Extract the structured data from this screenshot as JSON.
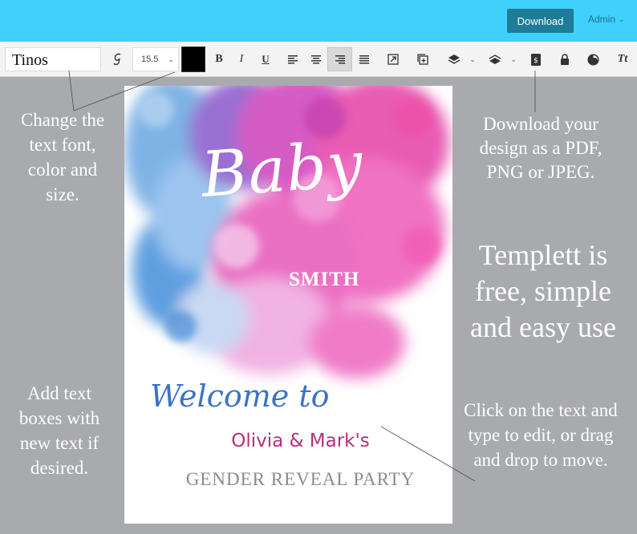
{
  "header": {
    "download_label": "Download",
    "admin_label": "Admin"
  },
  "toolbar": {
    "font_name": "Tinos",
    "font_size": "15.5",
    "text_color": "#000000",
    "icons": [
      "font-style-icon",
      "bold-icon",
      "italic-icon",
      "underline-icon",
      "align-left-icon",
      "align-center-icon",
      "align-right-icon",
      "align-justify-icon",
      "resize-icon",
      "duplicate-icon",
      "layer-up-icon",
      "layer-down-icon",
      "save-icon",
      "lock-icon",
      "opacity-icon",
      "text-case-icon"
    ],
    "bold": "B",
    "italic": "I",
    "underline": "U",
    "text_case": "Tt"
  },
  "canvas": {
    "baby": "Baby",
    "surname": "SMITH",
    "welcome": "Welcome to",
    "names": "Olivia & Mark's",
    "event": "GENDER REVEAL PARTY",
    "colors": {
      "blue": "#3b73c4",
      "pink": "#b5307a",
      "gray": "#8b8b8b"
    }
  },
  "annotations": {
    "font_note": "Change the text font, color and size.",
    "download_note": "Download your design as a PDF, PNG or JPEG.",
    "free_note": "Templett is free, simple and easy use",
    "add_note": "Add text boxes with new text if desired.",
    "click_note": "Click on the text and type to edit, or drag and drop to move."
  },
  "colors": {
    "header": "#3fd0fb",
    "download_button": "#1f7c96",
    "background": "#a9aaae"
  }
}
